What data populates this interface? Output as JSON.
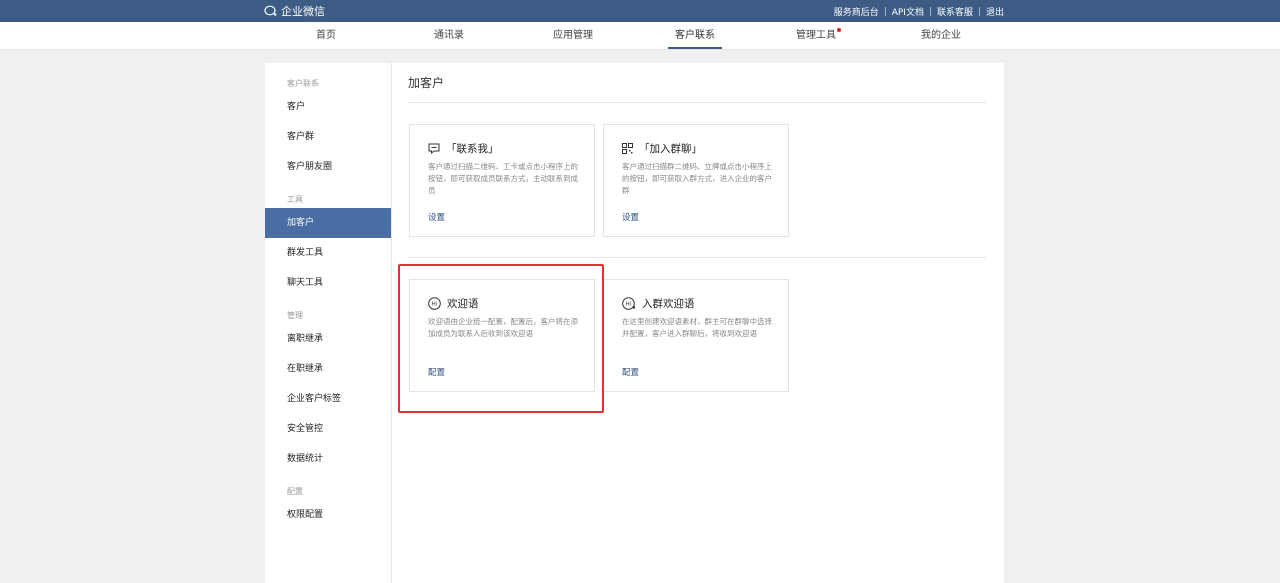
{
  "topbar": {
    "logo_text": "企业微信",
    "links": [
      "服务商后台",
      "API文档",
      "联系客服",
      "退出"
    ]
  },
  "nav": {
    "items": [
      "首页",
      "通讯录",
      "应用管理",
      "客户联系",
      "管理工具",
      "我的企业"
    ],
    "active": "客户联系"
  },
  "sidebar": {
    "group1": "客户联系",
    "item_customer": "客户",
    "item_customer_group": "客户群",
    "item_moments": "客户朋友圈",
    "group2": "工具",
    "item_add_customer": "加客户",
    "item_mass_send": "群发工具",
    "item_chat_tools": "聊天工具",
    "group3": "管理",
    "item_resign_inherit": "离职继承",
    "item_onjob_inherit": "在职继承",
    "item_customer_tags": "企业客户标签",
    "item_security": "安全管控",
    "item_stats": "数据统计",
    "group4": "配置",
    "item_permissions": "权限配置"
  },
  "main": {
    "title": "加客户",
    "cards": [
      {
        "title": "「联系我」",
        "desc": "客户通过扫描二维码、工卡或点击小程序上的按钮，即可获取成员联系方式，主动联系到成员",
        "link": "设置"
      },
      {
        "title": "「加入群聊」",
        "desc": "客户通过扫描群二维码、立牌或点击小程序上的按钮，即可获取入群方式，进入企业的客户群",
        "link": "设置"
      },
      {
        "title": "欢迎语",
        "desc": "欢迎语由企业统一配置，配置后，客户将在添加成员为联系人后收到该欢迎语",
        "link": "配置"
      },
      {
        "title": "入群欢迎语",
        "desc": "在这里创建欢迎语素材，群主可在群聊中选择并配置，客户进入群聊后，将收到欢迎语",
        "link": "配置"
      }
    ]
  },
  "colors": {
    "topbar": "#3c5b85",
    "sidebar_active": "#4a6ea3",
    "link": "#2f4f7f",
    "highlight": "#e03030",
    "notify_dot": "#e02020"
  }
}
